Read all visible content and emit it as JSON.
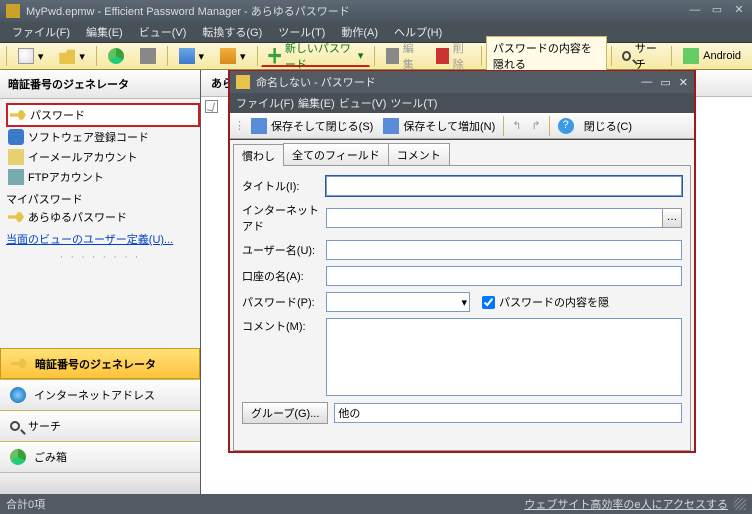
{
  "title": "MyPwd.epmw - Efficient Password Manager - あらゆるパスワード",
  "menu": {
    "file": "ファイル(F)",
    "edit": "編集(E)",
    "view": "ビュー(V)",
    "convert": "転換する(G)",
    "tools": "ツール(T)",
    "action": "動作(A)",
    "help": "ヘルプ(H)"
  },
  "toolbar": {
    "new": "新しいパスワード",
    "edit": "編集",
    "delete": "削除",
    "hide": "パスワードの内容を隠れる",
    "search": "サーチ",
    "android": "Android"
  },
  "sidebar": {
    "header": "暗証番号のジェネレータ",
    "items": [
      "パスワード",
      "ソフトウェア登録コード",
      "イーメールアカウント",
      "FTPアカウント"
    ],
    "mypwd": "マイパスワード",
    "all": "あらゆるパスワード",
    "userdef": "当面のビューのユーザー定義(U)...",
    "btns": {
      "gen": "暗証番号のジェネレータ",
      "net": "インターネットアドレス",
      "search": "サーチ",
      "trash": "ごみ箱"
    }
  },
  "content": {
    "header": "あらゆるパスワード"
  },
  "modal": {
    "title": "命名しない - パスワード",
    "menu": {
      "file": "ファイル(F)",
      "edit": "編集(E)",
      "view": "ビュー(V)",
      "tools": "ツール(T)"
    },
    "tools": {
      "saveclose": "保存そして閉じる(S)",
      "saveadd": "保存そして増加(N)",
      "close": "閉じる(C)"
    },
    "tabs": {
      "t1": "慣わし",
      "t2": "全てのフィールド",
      "t3": "コメント"
    },
    "form": {
      "title": "タイトル(I):",
      "url": "インターネットアド",
      "user": "ユーザー名(U):",
      "acct": "口座の名(A):",
      "pwd": "パスワード(P):",
      "hide": "パスワードの内容を隠",
      "comment": "コメント(M):",
      "group": "グループ(G)...",
      "group_val": "他の"
    }
  },
  "status": {
    "count": "合計0項",
    "link": "ウェブサイト高効率のe人にアクセスする"
  }
}
